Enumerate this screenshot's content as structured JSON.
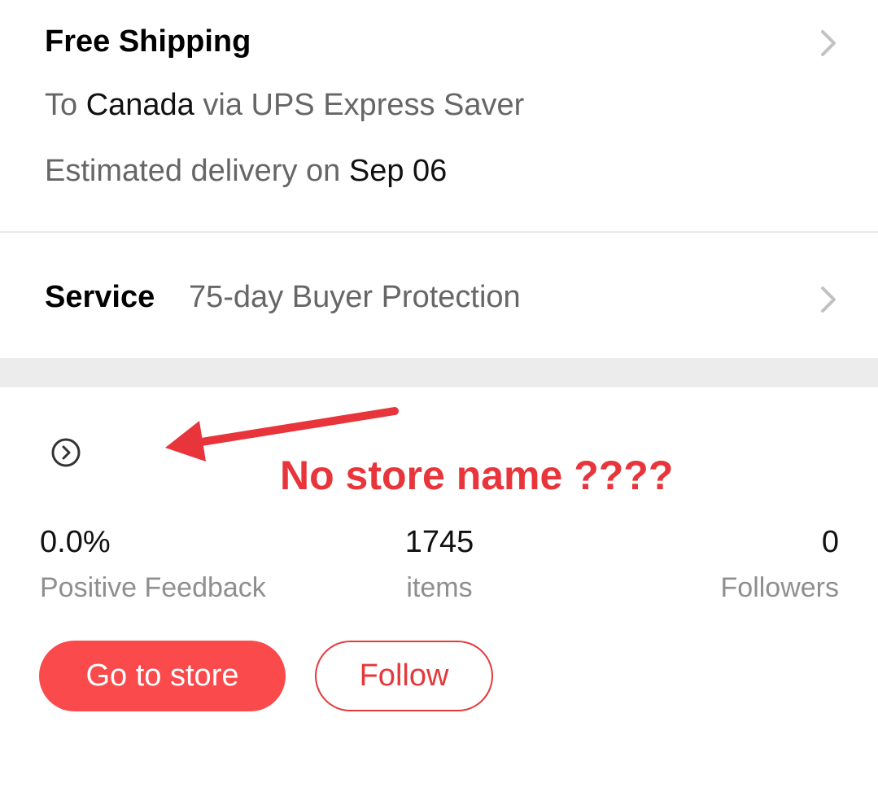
{
  "shipping": {
    "title": "Free Shipping",
    "to_prefix": "To ",
    "destination": "Canada",
    "via_text": " via UPS Express Saver",
    "delivery_prefix": "Estimated delivery on ",
    "delivery_date": "Sep 06",
    "icon": "chevron-right-icon"
  },
  "service": {
    "label": "Service",
    "value": "75-day Buyer Protection",
    "icon": "chevron-right-icon"
  },
  "store": {
    "name_icon": "circle-chevron-right-icon",
    "annotation": {
      "text": "No store name ????",
      "color": "#e8353b",
      "icon": "arrow-left-annotation"
    },
    "stats": {
      "feedback_value": "0.0%",
      "feedback_label": "Positive Feedback",
      "items_value": "1745",
      "items_label": "items",
      "followers_value": "0",
      "followers_label": "Followers"
    },
    "buttons": {
      "go_to_store": "Go to store",
      "follow": "Follow"
    }
  },
  "colors": {
    "accent": "#fa4a4c",
    "follow_border": "#e5383b",
    "muted_text": "#666666",
    "label_text": "#8f8f8f",
    "band": "#ececec"
  }
}
